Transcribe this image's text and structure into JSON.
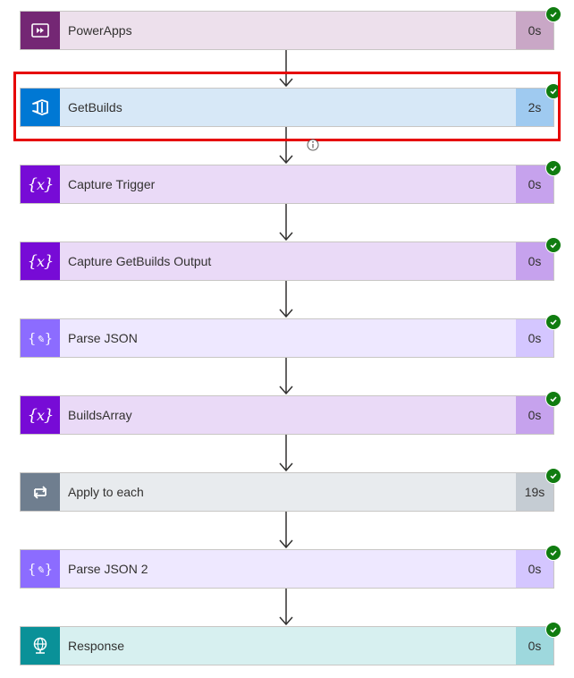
{
  "steps": [
    {
      "title": "PowerApps",
      "duration": "0s",
      "bg": "#ede0ec",
      "durBg": "#c9a7c6",
      "iconBg": "#742774",
      "icon": "powerapps-icon"
    },
    {
      "title": "GetBuilds",
      "duration": "2s",
      "bg": "#d7e8f7",
      "durBg": "#9fcaf0",
      "iconBg": "#0078d4",
      "icon": "azure-devops-icon"
    },
    {
      "title": "Capture Trigger",
      "duration": "0s",
      "bg": "#eadaf7",
      "durBg": "#c6a2ed",
      "iconBg": "#770bd6",
      "icon": "variable-icon"
    },
    {
      "title": "Capture GetBuilds Output",
      "duration": "0s",
      "bg": "#eadaf7",
      "durBg": "#c6a2ed",
      "iconBg": "#770bd6",
      "icon": "variable-icon"
    },
    {
      "title": "Parse JSON",
      "duration": "0s",
      "bg": "#eee8ff",
      "durBg": "#d4c6ff",
      "iconBg": "#8c6cff",
      "icon": "parse-json-icon"
    },
    {
      "title": "BuildsArray",
      "duration": "0s",
      "bg": "#eadaf7",
      "durBg": "#c6a2ed",
      "iconBg": "#770bd6",
      "icon": "variable-icon"
    },
    {
      "title": "Apply to each",
      "duration": "19s",
      "bg": "#e8ebee",
      "durBg": "#c5ccd3",
      "iconBg": "#6f7e8f",
      "icon": "loop-icon"
    },
    {
      "title": "Parse JSON 2",
      "duration": "0s",
      "bg": "#eee8ff",
      "durBg": "#d4c6ff",
      "iconBg": "#8c6cff",
      "icon": "parse-json-icon"
    },
    {
      "title": "Response",
      "duration": "0s",
      "bg": "#d7f0f0",
      "durBg": "#9ed8dd",
      "iconBg": "#0a9198",
      "icon": "globe-icon"
    }
  ],
  "colors": {
    "success": "#107c10",
    "highlight": "#e60000",
    "arrow": "#323130"
  }
}
